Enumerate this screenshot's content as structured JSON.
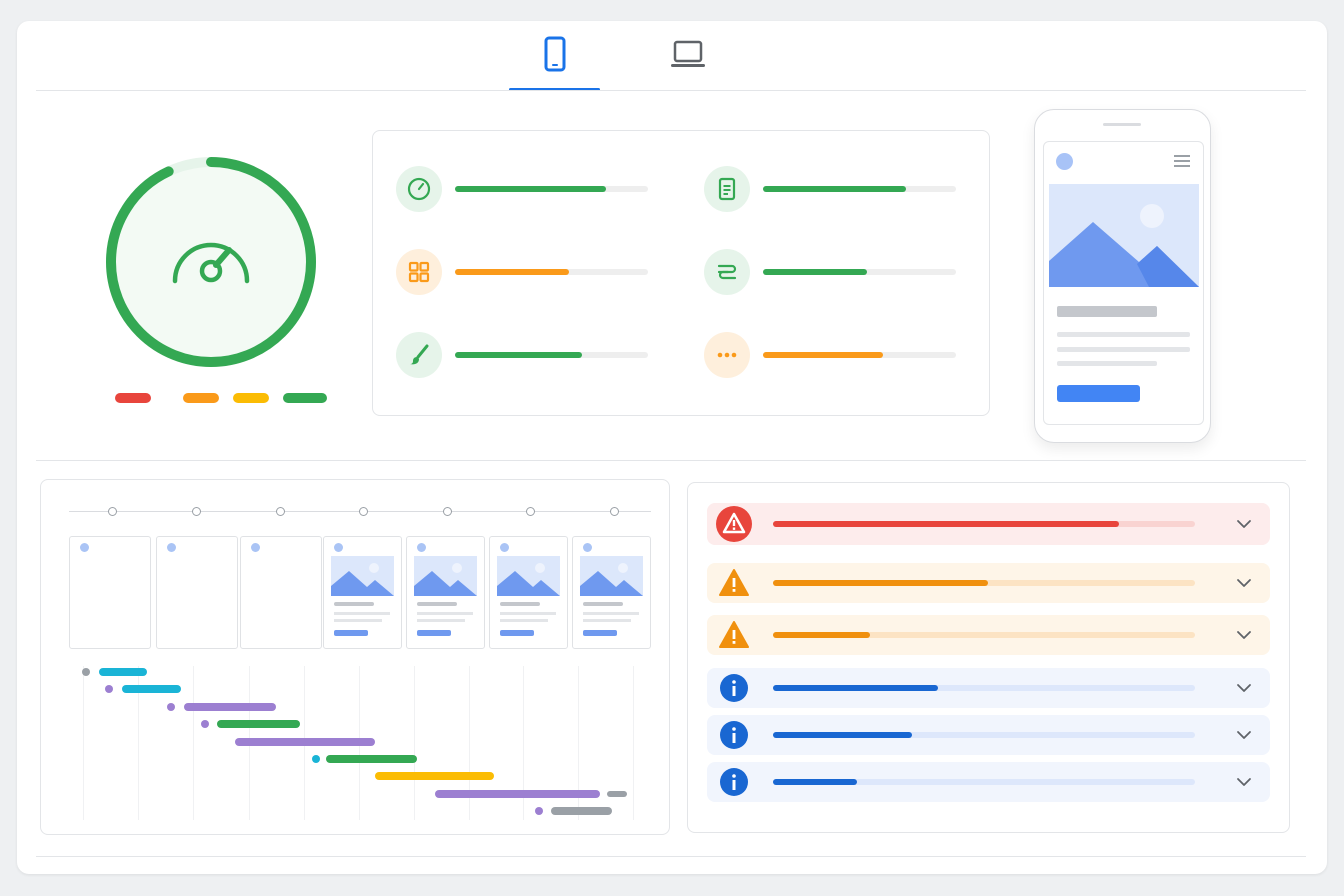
{
  "tabs": [
    {
      "id": "mobile",
      "icon": "smartphone-icon",
      "active": true
    },
    {
      "id": "desktop",
      "icon": "laptop-icon",
      "active": false
    }
  ],
  "colors": {
    "accent": "#1a73e8",
    "good": "#34a853",
    "average": "#fa9a1a",
    "poor": "#e8453c",
    "caution": "#fbbc04",
    "info": "#1967d2",
    "track": "#eeeeee"
  },
  "gauge": {
    "icon": "speedometer-icon",
    "level": 0.93,
    "legend": [
      {
        "color": "#e8453c"
      },
      {
        "color": "#fa9a1a"
      },
      {
        "color": "#fbbc04"
      },
      {
        "color": "#34a853"
      }
    ]
  },
  "metrics": [
    {
      "icon": "timer-icon",
      "color": "#34a853",
      "bg": "#e6f4ea",
      "fill": 0.78
    },
    {
      "icon": "document-icon",
      "color": "#34a853",
      "bg": "#e6f4ea",
      "fill": 0.74
    },
    {
      "icon": "grid-icon",
      "color": "#fa9a1a",
      "bg": "#feefdc",
      "fill": 0.59
    },
    {
      "icon": "layout-shift-icon",
      "color": "#34a853",
      "bg": "#e6f4ea",
      "fill": 0.54
    },
    {
      "icon": "paintbrush-icon",
      "color": "#34a853",
      "bg": "#e6f4ea",
      "fill": 0.66
    },
    {
      "icon": "more-icon",
      "color": "#fa9a1a",
      "bg": "#feefdc",
      "fill": 0.62
    }
  ],
  "filmstrip": {
    "frames": [
      {
        "loaded": false
      },
      {
        "loaded": false
      },
      {
        "loaded": false
      },
      {
        "loaded": true
      },
      {
        "loaded": true
      },
      {
        "loaded": true
      },
      {
        "loaded": true
      }
    ]
  },
  "waterfall": [
    {
      "color": "#1ab4d6",
      "dot": "#9aa0a6"
    },
    {
      "color": "#1ab4d6",
      "dot": "#9c7fd1"
    },
    {
      "color": "#9c7fd1",
      "dot": "#9c7fd1"
    },
    {
      "color": "#34a853",
      "dot": "#9c7fd1"
    },
    {
      "color": "#9c7fd1",
      "dot": ""
    },
    {
      "color": "#34a853",
      "dot": "#1ab4d6"
    },
    {
      "color": "#fbbc04",
      "dot": ""
    },
    {
      "color": "#9c7fd1",
      "dot": ""
    },
    {
      "color": "#9aa0a6",
      "dot": "#9c7fd1"
    }
  ],
  "issues": [
    {
      "severity": "error",
      "icon": "error-alert-icon",
      "color": "#e8453c",
      "bg": "#fdecec",
      "track": "#f9d3d1",
      "fill": 0.82
    },
    {
      "severity": "warning",
      "icon": "warning-triangle-icon",
      "color": "#f0900e",
      "bg": "#fef5e8",
      "track": "#fce3c3",
      "fill": 0.51
    },
    {
      "severity": "warning",
      "icon": "warning-triangle-icon",
      "color": "#f0900e",
      "bg": "#fef5e8",
      "track": "#fce3c3",
      "fill": 0.23
    },
    {
      "severity": "info",
      "icon": "info-circle-icon",
      "color": "#1967d2",
      "bg": "#f1f5fd",
      "track": "#dde7fb",
      "fill": 0.39
    },
    {
      "severity": "info",
      "icon": "info-circle-icon",
      "color": "#1967d2",
      "bg": "#f1f5fd",
      "track": "#dde7fb",
      "fill": 0.33
    },
    {
      "severity": "info",
      "icon": "info-circle-icon",
      "color": "#1967d2",
      "bg": "#f1f5fd",
      "track": "#dde7fb",
      "fill": 0.2
    }
  ]
}
